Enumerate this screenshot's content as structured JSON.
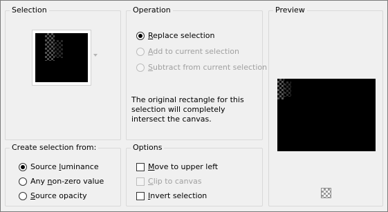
{
  "selection": {
    "title": "Selection"
  },
  "operation": {
    "title": "Operation",
    "options": [
      {
        "prefix": "",
        "accel": "R",
        "rest": "eplace selection",
        "checked": true,
        "disabled": false
      },
      {
        "prefix": "",
        "accel": "A",
        "rest": "dd to current selection",
        "checked": false,
        "disabled": true
      },
      {
        "prefix": "",
        "accel": "S",
        "rest": "ubtract from current selection",
        "checked": false,
        "disabled": true
      }
    ],
    "info": "The original rectangle for this selection will completely intersect the canvas."
  },
  "preview": {
    "title": "Preview"
  },
  "create_from": {
    "title": "Create selection from:",
    "options": [
      {
        "prefix": "Source ",
        "accel": "l",
        "rest": "uminance",
        "checked": true
      },
      {
        "prefix": "Any ",
        "accel": "n",
        "rest": "on-zero value",
        "checked": false
      },
      {
        "prefix": "",
        "accel": "S",
        "rest": "ource opacity",
        "checked": false
      }
    ]
  },
  "options_group": {
    "title": "Options",
    "items": [
      {
        "prefix": "",
        "accel": "M",
        "rest": "ove to upper left",
        "checked": false,
        "disabled": false
      },
      {
        "prefix": "",
        "accel": "C",
        "rest": "lip to canvas",
        "checked": false,
        "disabled": true
      },
      {
        "prefix": "",
        "accel": "I",
        "rest": "nvert selection",
        "checked": false,
        "disabled": false
      }
    ]
  },
  "colors": {
    "border": "#d9d9d9",
    "background": "#f0f0f0",
    "disabled_text": "#a0a0a0"
  }
}
